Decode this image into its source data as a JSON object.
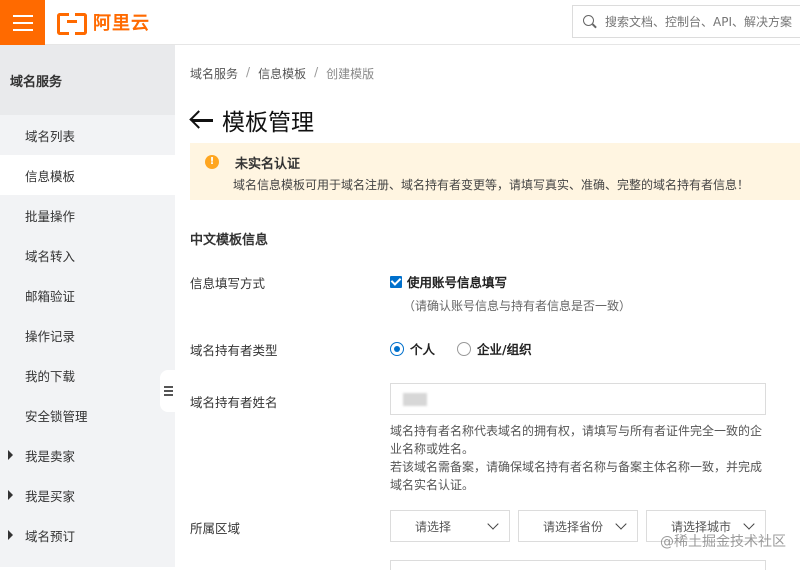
{
  "header": {
    "logo_text": "阿里云",
    "search_placeholder": "搜索文档、控制台、API、解决方案"
  },
  "sidebar": {
    "title": "域名服务",
    "items": [
      {
        "label": "域名列表"
      },
      {
        "label": "信息模板",
        "active": true
      },
      {
        "label": "批量操作"
      },
      {
        "label": "域名转入"
      },
      {
        "label": "邮箱验证"
      },
      {
        "label": "操作记录"
      },
      {
        "label": "我的下载"
      },
      {
        "label": "安全锁管理"
      },
      {
        "label": "我是卖家",
        "expandable": true
      },
      {
        "label": "我是买家",
        "expandable": true
      },
      {
        "label": "域名预订",
        "expandable": true
      }
    ]
  },
  "breadcrumb": [
    "域名服务",
    "信息模板",
    "创建模版"
  ],
  "page": {
    "title": "模板管理"
  },
  "alert": {
    "title": "未实名认证",
    "text": "域名信息模板可用于域名注册、域名持有者变更等，请填写真实、准确、完整的域名持有者信息！"
  },
  "form": {
    "section_title": "中文模板信息",
    "fill_method_label": "信息填写方式",
    "use_account_info_label": "使用账号信息填写",
    "use_account_info_checked": true,
    "use_account_info_hint": "（请确认账号信息与持有者信息是否一致）",
    "holder_type_label": "域名持有者类型",
    "holder_type_options": [
      "个人",
      "企业/组织"
    ],
    "holder_type_selected": "个人",
    "holder_name_label": "域名持有者姓名",
    "holder_name_desc_1": "域名持有者名称代表域名的拥有权，请填写与所有者证件完全一致的企业名称或姓名。",
    "holder_name_desc_2": "若该域名需备案，请确保域名持有者名称与备案主体名称一致，并完成域名实名认证。",
    "region_label": "所属区域",
    "region_selects": [
      "请选择",
      "请选择省份",
      "请选择城市"
    ]
  },
  "watermark": "@稀土掘金技术社区",
  "colors": {
    "brand": "#ff6a00",
    "primary": "#0070cc",
    "warning_bg": "#fff5e1",
    "warning_icon": "#ffa620"
  }
}
